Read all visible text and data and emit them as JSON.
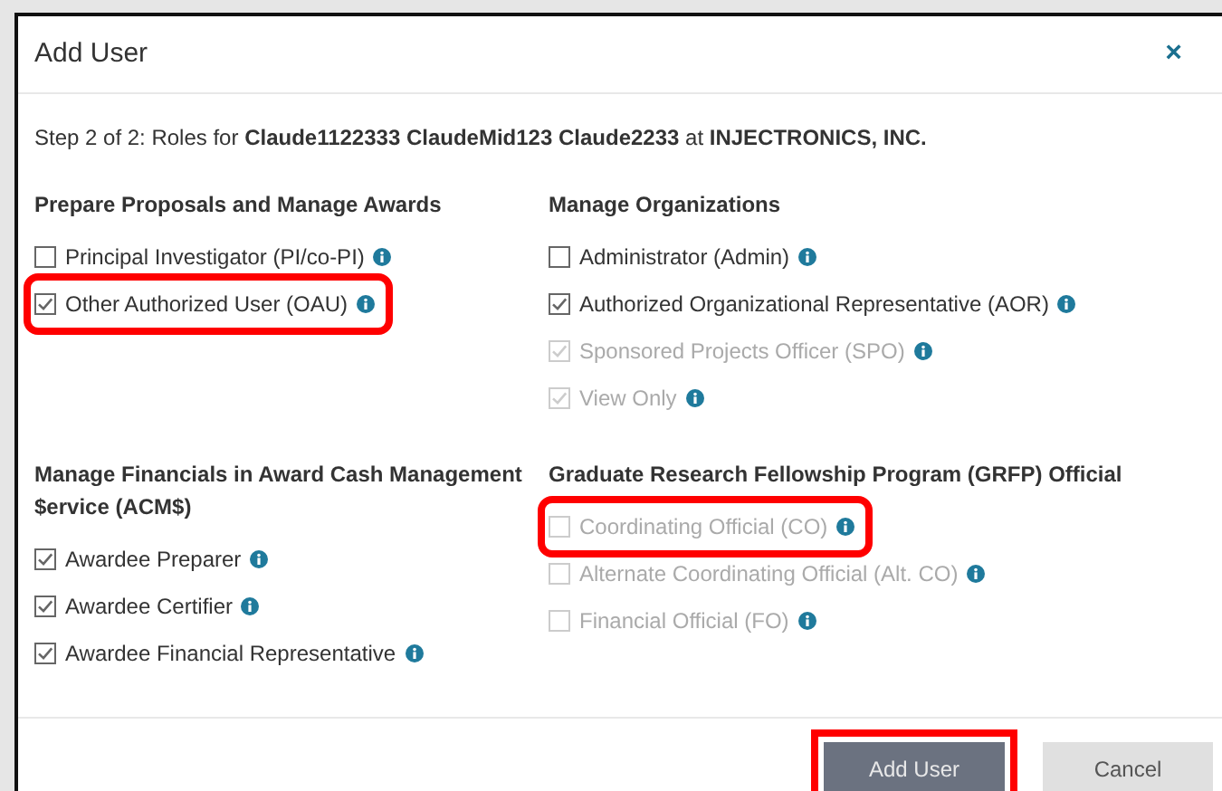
{
  "dialog": {
    "title": "Add User",
    "close": "×",
    "step": "Step 2 of 2: Roles for **Claude1122333 ClaudeMid123 Claude2233** at **INJECTRONICS, INC.**",
    "sections": [
      {
        "title": "Prepare Proposals and Manage Awards",
        "items": [
          {
            "label": "Principal Investigator (PI/co-PI)",
            "checked": false,
            "disabled": false,
            "highlighted": false
          },
          {
            "label": "Other Authorized User (OAU)",
            "checked": true,
            "disabled": false,
            "highlighted": true
          }
        ]
      },
      {
        "title": "Manage Organizations",
        "items": [
          {
            "label": "Administrator (Admin)",
            "checked": false,
            "disabled": false,
            "highlighted": false
          },
          {
            "label": "Authorized Organizational Representative (AOR)",
            "checked": true,
            "disabled": false,
            "highlighted": false
          },
          {
            "label": "Sponsored Projects Officer (SPO)",
            "checked": true,
            "disabled": true,
            "highlighted": false
          },
          {
            "label": "View Only",
            "checked": true,
            "disabled": true,
            "highlighted": false
          }
        ]
      },
      {
        "title": "Manage Financials in Award Cash Management $ervice (ACM$)",
        "items": [
          {
            "label": "Awardee Preparer",
            "checked": true,
            "disabled": false,
            "highlighted": false
          },
          {
            "label": "Awardee Certifier",
            "checked": true,
            "disabled": false,
            "highlighted": false
          },
          {
            "label": "Awardee Financial Representative",
            "checked": true,
            "disabled": false,
            "highlighted": false
          }
        ]
      },
      {
        "title": "Graduate Research Fellowship Program (GRFP) Official",
        "items": [
          {
            "label": "Coordinating Official (CO)",
            "checked": false,
            "disabled": true,
            "highlighted": true
          },
          {
            "label": "Alternate Coordinating Official (Alt. CO)",
            "checked": false,
            "disabled": true,
            "highlighted": false
          },
          {
            "label": "Financial Official (FO)",
            "checked": false,
            "disabled": true,
            "highlighted": false
          }
        ]
      }
    ],
    "buttons": [
      {
        "label": "Add User",
        "kind": "primary",
        "highlighted": true
      },
      {
        "label": "Cancel",
        "kind": "secondary",
        "highlighted": false
      }
    ]
  }
}
